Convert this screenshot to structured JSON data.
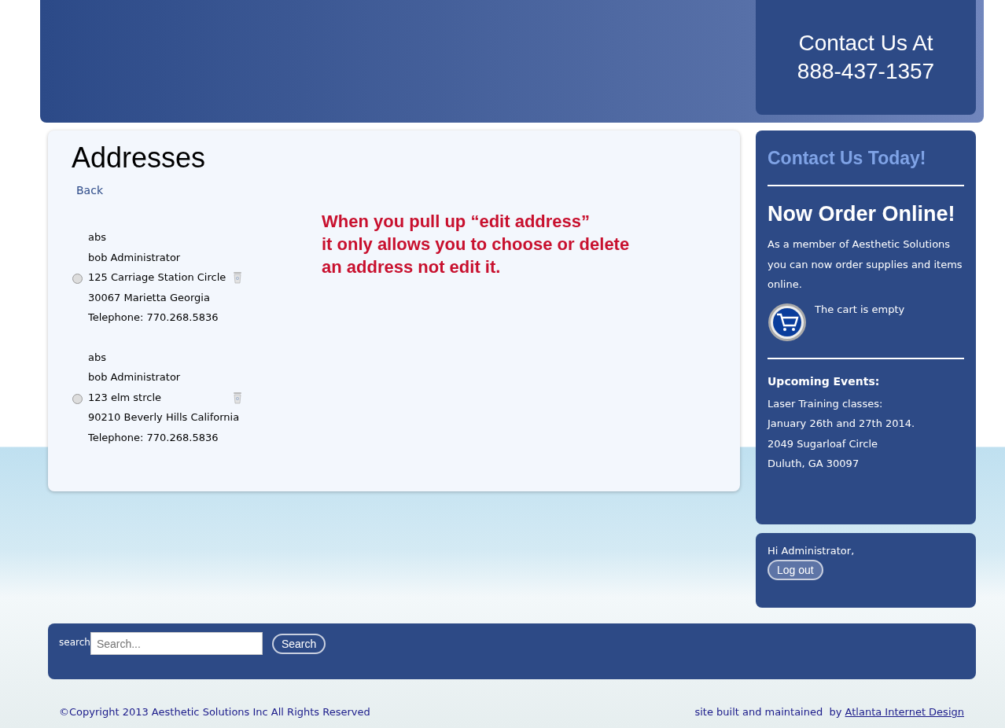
{
  "header": {
    "contact_lines": [
      "Contact Us At",
      "888-437-1357"
    ]
  },
  "main": {
    "title": "Addresses",
    "back_link": "Back",
    "addresses": [
      {
        "selected": false,
        "lines": [
          "abs",
          "bob Administrator",
          "125 Carriage Station Circle",
          "30067 Marietta Georgia",
          "Telephone: 770.268.5836"
        ]
      },
      {
        "selected": false,
        "lines": [
          "abs",
          "bob Administrator",
          "123 elm strcle",
          "90210 Beverly Hills California",
          "Telephone: 770.268.5836"
        ]
      }
    ],
    "annotation_lines": [
      "When you pull up “edit address”",
      "it only allows you to choose or delete",
      "an address not edit it."
    ]
  },
  "sidebar": {
    "contact_heading": "Contact Us Today!",
    "order_heading": "Now Order Online!",
    "order_text": "As a member of Aesthetic Solutions you can now order supplies and items online.",
    "cart_text": "The cart is empty",
    "events_heading": "Upcoming Events:",
    "events_lines": [
      "Laser Training classes:",
      "January 26th and 27th 2014.",
      "2049 Sugarloaf Circle",
      "Duluth, GA 30097"
    ],
    "greeting": "Hi Administrator,",
    "logout": "Log out"
  },
  "search": {
    "label": "search",
    "placeholder": "Search...",
    "button": "Search"
  },
  "footer": {
    "copyright": "©Copyright 2013 Aesthetic Solutions Inc All Rights Reserved",
    "credit": "site built and maintained  by",
    "credit_link": "Atlanta Internet Design"
  }
}
